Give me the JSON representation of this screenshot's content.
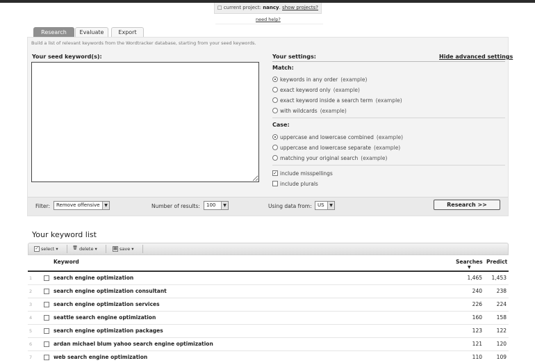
{
  "header": {
    "current_project_label": "current project:",
    "project_name": "nancy",
    "show_projects": "show projects?",
    "need_help": "need help?"
  },
  "tabs": [
    {
      "label": "Research",
      "active": true
    },
    {
      "label": "Evaluate",
      "active": false
    },
    {
      "label": "Export",
      "active": false
    }
  ],
  "research": {
    "intro": "Build a list of relevant keywords from the Wordtracker database, starting from your seed keywords.",
    "seed_label": "Your seed keyword(s):",
    "seed_value": "",
    "settings_label": "Your settings:",
    "hide_advanced": "Hide advanced settings",
    "match": {
      "title": "Match:",
      "options": [
        {
          "label": "keywords in any order",
          "example": "(example)",
          "selected": true
        },
        {
          "label": "exact keyword only",
          "example": "(example)",
          "selected": false
        },
        {
          "label": "exact keyword inside a search term",
          "example": "(example)",
          "selected": false
        },
        {
          "label": "with wildcards",
          "example": "(example)",
          "selected": false
        }
      ]
    },
    "case": {
      "title": "Case:",
      "options": [
        {
          "label": "uppercase and lowercase combined",
          "example": "(example)",
          "selected": true
        },
        {
          "label": "uppercase and lowercase separate",
          "example": "(example)",
          "selected": false
        },
        {
          "label": "matching your original search",
          "example": "(example)",
          "selected": false
        }
      ]
    },
    "checkboxes": [
      {
        "label": "include misspellings",
        "checked": true
      },
      {
        "label": "include plurals",
        "checked": false
      }
    ],
    "filter_label": "Filter:",
    "filter_value": "Remove offensive",
    "results_label": "Number of results:",
    "results_value": "100",
    "data_from_label": "Using data from:",
    "data_from_value": "US",
    "research_button": "Research >>"
  },
  "keyword_list": {
    "title": "Your keyword list",
    "toolbar": {
      "select": "select",
      "delete": "delete",
      "save": "save"
    },
    "columns": {
      "keyword": "Keyword",
      "searches": "Searches",
      "predict": "Predict"
    },
    "rows": [
      {
        "num": "1",
        "keyword": "search engine optimization",
        "searches": "1,465",
        "predict": "1,453"
      },
      {
        "num": "2",
        "keyword": "search engine optimization consultant",
        "searches": "240",
        "predict": "238"
      },
      {
        "num": "3",
        "keyword": "search engine optimization services",
        "searches": "226",
        "predict": "224"
      },
      {
        "num": "4",
        "keyword": "seattle search engine optimization",
        "searches": "160",
        "predict": "158"
      },
      {
        "num": "5",
        "keyword": "search engine optimization packages",
        "searches": "123",
        "predict": "122"
      },
      {
        "num": "6",
        "keyword": "ardan michael blum yahoo search engine optimization",
        "searches": "121",
        "predict": "120"
      },
      {
        "num": "7",
        "keyword": "web search engine optimization",
        "searches": "110",
        "predict": "109"
      }
    ]
  },
  "icons": {
    "project": "folder-icon",
    "select": "checkbox-icon",
    "delete": "trash-icon",
    "save": "disk-icon",
    "sort": "sort-down-icon"
  }
}
